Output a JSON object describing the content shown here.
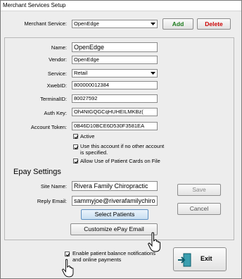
{
  "window": {
    "title": "Merchant Services Setup"
  },
  "merchant_service": {
    "label": "Merchant Service:",
    "value": "OpenEdge"
  },
  "buttons": {
    "add": "Add",
    "delete": "Delete",
    "save": "Save",
    "cancel": "Cancel",
    "select_patients": "Select Patients",
    "customize_email": "Customize ePay Email",
    "exit": "Exit"
  },
  "form": {
    "name_label": "Name:",
    "name_value": "OpenEdge",
    "vendor_label": "Vendor:",
    "vendor_value": "OpenEdge",
    "service_label": "Service:",
    "service_value": "Retail",
    "xweb_label": "XwebID:",
    "xweb_value": "800000012384",
    "terminal_label": "TerminalID:",
    "terminal_value": "80027592",
    "authkey_label": "Auth Key:",
    "authkey_value": "Oh4NtGQGCqHUHEILMKBz(",
    "token_label": "Account Token:",
    "token_value": "0B46D10BCE6D530F3581EA"
  },
  "checkboxes": {
    "active": "Active",
    "default_line1": "Use this account if no other account",
    "default_line2": "is specified.",
    "patient_cards": "Allow Use of Patient Cards on File"
  },
  "epay": {
    "heading": "Epay Settings",
    "site_label": "Site Name:",
    "site_value": "Rivera Family Chiropractic",
    "reply_label": "Reply Email:",
    "reply_value": "sammyjoe@riverafamilychiro"
  },
  "notify": {
    "line1": "Enable patient balance notifications",
    "line2": "and online payments"
  },
  "colors": {
    "add_text": "#1a7a1a",
    "delete_text": "#cc0000",
    "exit_icon": "#1a8fa0"
  }
}
